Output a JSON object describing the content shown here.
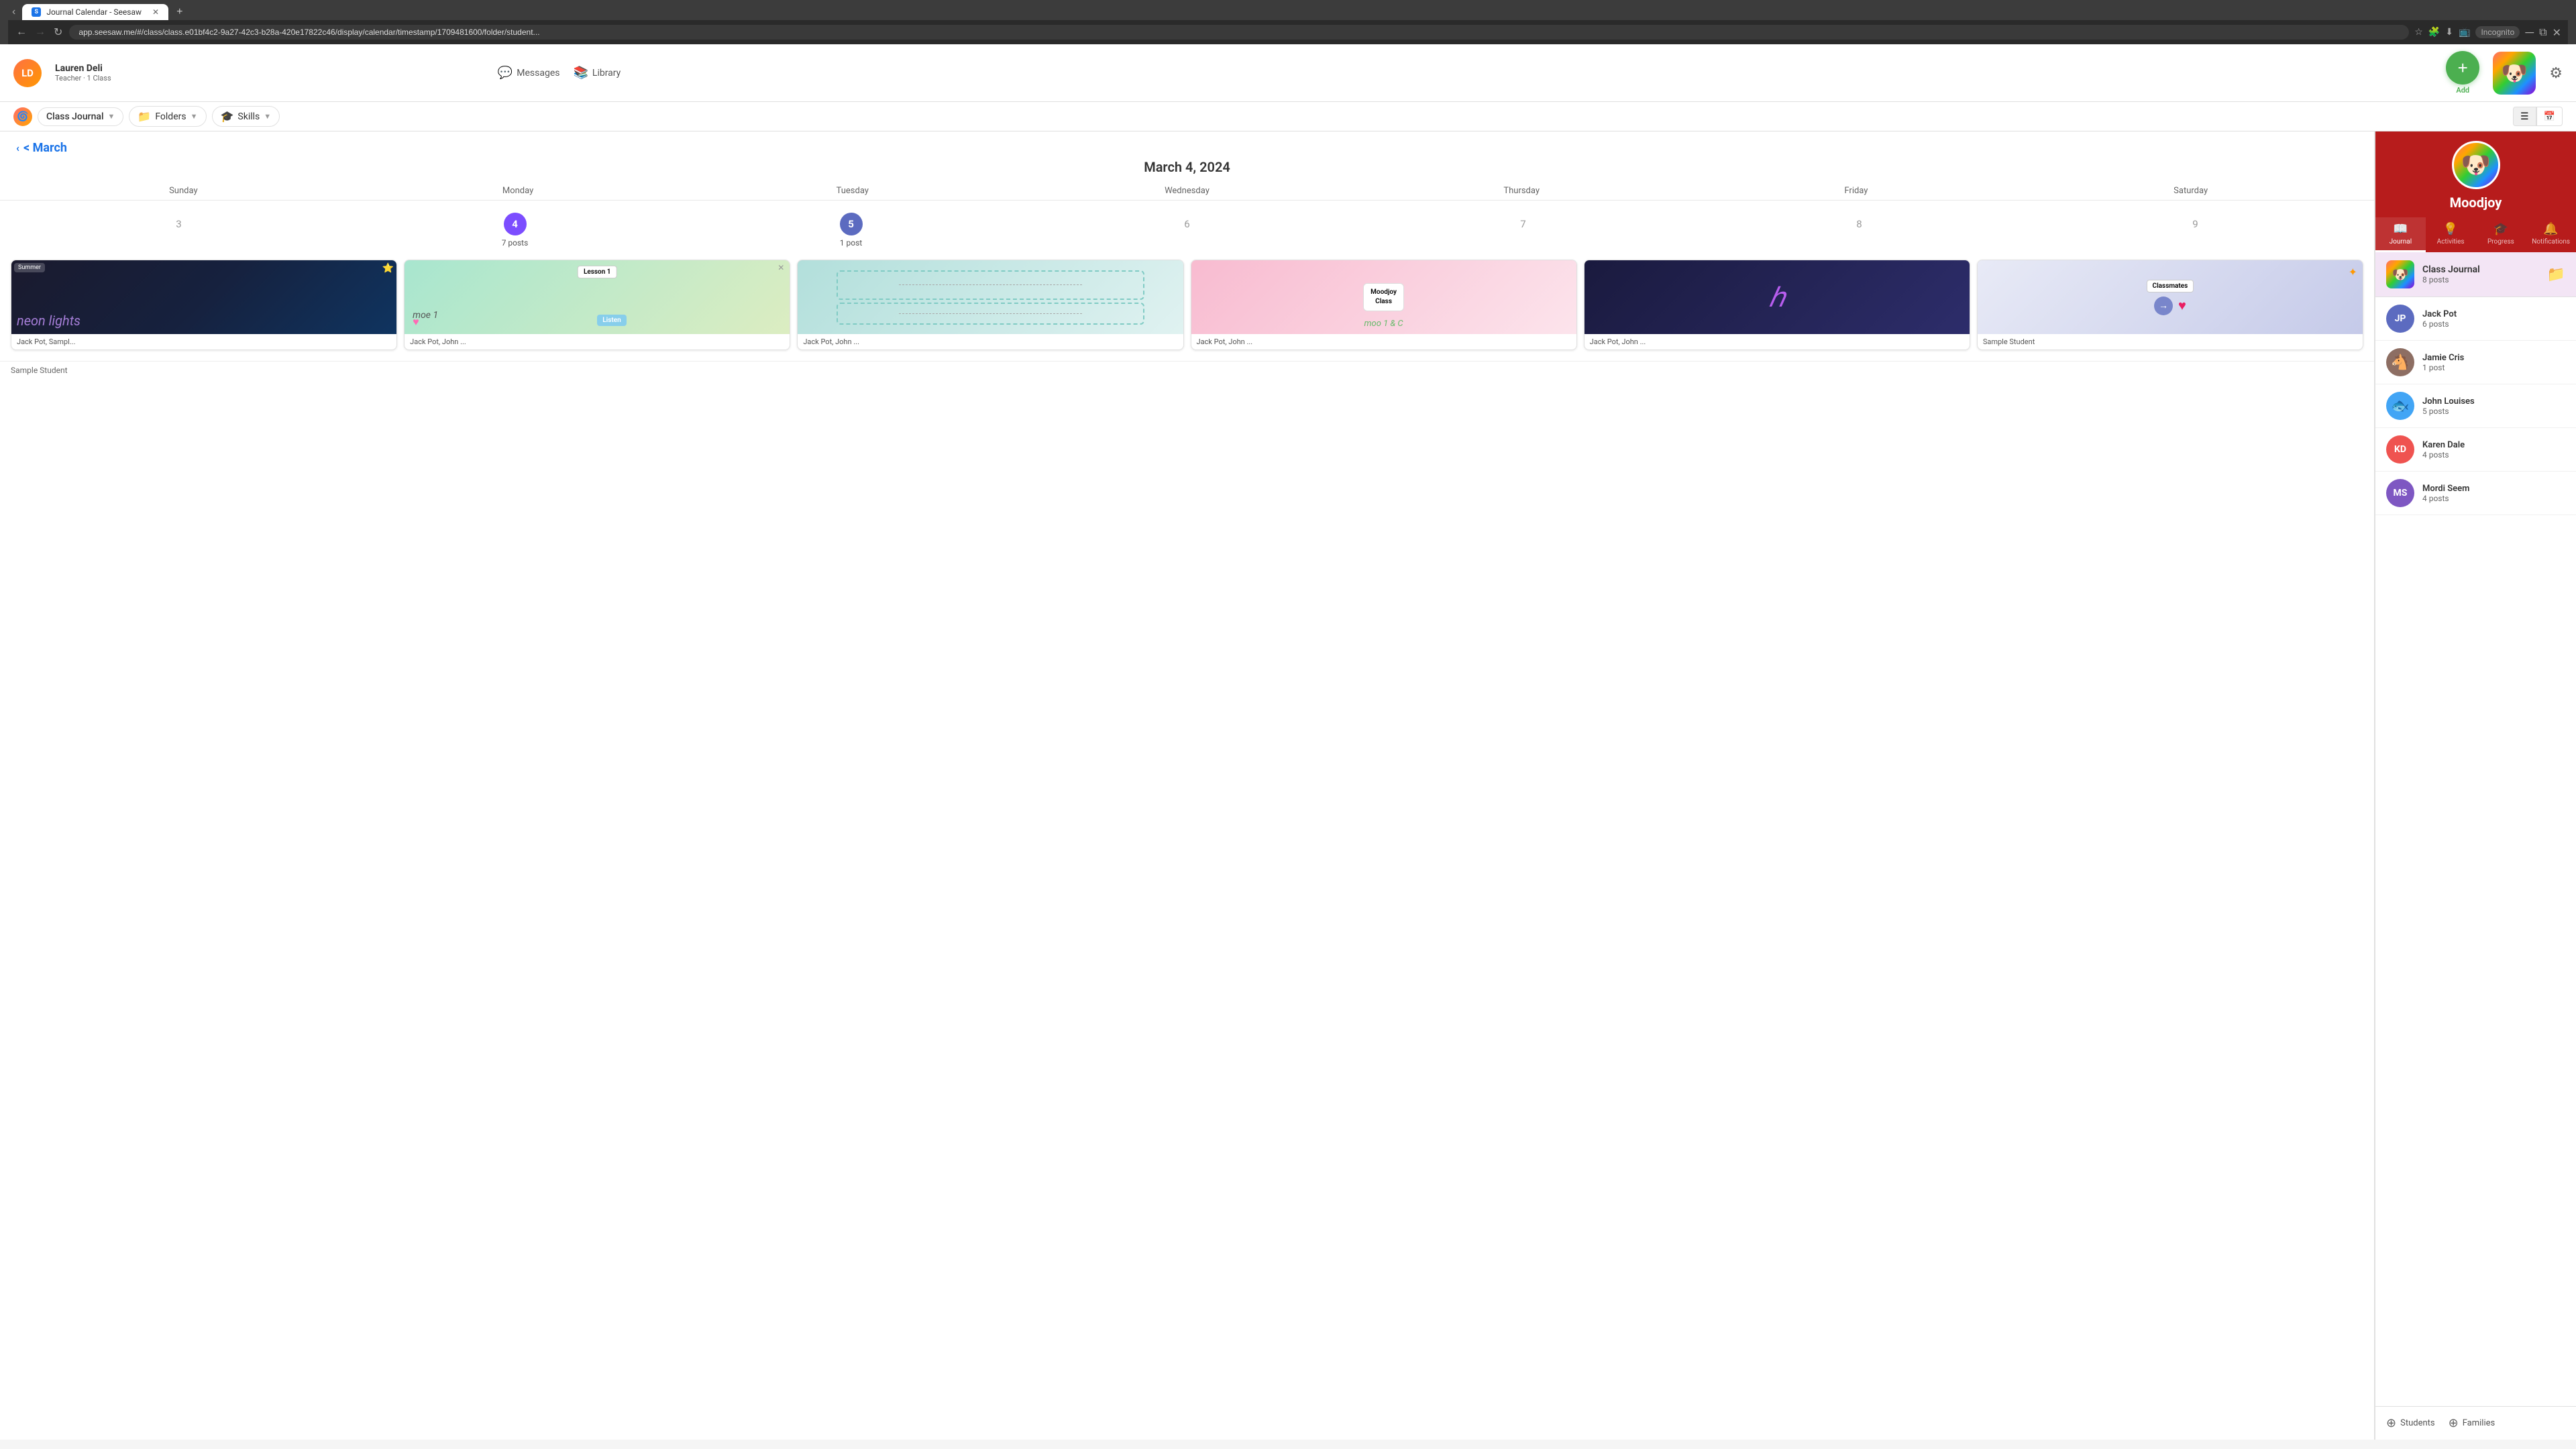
{
  "browser": {
    "tab_favicon": "S",
    "tab_title": "Journal Calendar - Seesaw",
    "address": "app.seesaw.me/#/class/class.e01bf4c2-9a27-42c3-b28a-420e17822c46/display/calendar/timestamp/1709481600/folder/student...",
    "nav_back": "←",
    "nav_forward": "→",
    "nav_reload": "↻"
  },
  "top_nav": {
    "user_initials": "LD",
    "user_name": "Lauren Deli",
    "user_role": "Teacher · 1 Class",
    "messages_label": "Messages",
    "library_label": "Library",
    "add_label": "Add",
    "gear_icon": "⚙"
  },
  "sub_nav": {
    "class_journal": "Class Journal",
    "folders": "Folders",
    "skills": "Skills"
  },
  "calendar": {
    "month_nav": "< March",
    "date_title": "March 4, 2024",
    "days": [
      "Sunday",
      "Monday",
      "Tuesday",
      "Wednesday",
      "Thursday",
      "Friday",
      "Saturday"
    ],
    "week_numbers": [
      {
        "num": "3",
        "active": false,
        "posts": ""
      },
      {
        "num": "4",
        "active": true,
        "posts": "7 posts"
      },
      {
        "num": "5",
        "active": true,
        "posts": "1 post"
      },
      {
        "num": "6",
        "active": false,
        "posts": ""
      },
      {
        "num": "7",
        "active": false,
        "posts": ""
      },
      {
        "num": "8",
        "active": false,
        "posts": ""
      },
      {
        "num": "9",
        "active": false,
        "posts": ""
      }
    ],
    "posts": [
      {
        "caption": "Jack Pot,  Sampl...",
        "thumb_class": "thumb-1"
      },
      {
        "caption": "Jack Pot,  John ...",
        "thumb_class": "thumb-2"
      },
      {
        "caption": "Jack Pot,  John ...",
        "thumb_class": "thumb-3"
      },
      {
        "caption": "Jack Pot,  John ...",
        "thumb_class": "thumb-4"
      },
      {
        "caption": "Jack Pot,  John ...",
        "thumb_class": "thumb-5"
      },
      {
        "caption": "Sample Student",
        "thumb_class": "thumb-6"
      }
    ],
    "sample_student_label": "Sample Student"
  },
  "sidebar": {
    "app_name": "Moodjoy",
    "tabs": [
      {
        "label": "Journal",
        "icon": "📖",
        "active": true
      },
      {
        "label": "Activities",
        "icon": "💡",
        "active": false
      },
      {
        "label": "Progress",
        "icon": "🎓",
        "active": false
      },
      {
        "label": "Notifications",
        "icon": "🔔",
        "active": false
      }
    ],
    "class_item": {
      "name": "Class Journal",
      "posts": "8 posts"
    },
    "students": [
      {
        "initials": "JP",
        "name": "Jack Pot",
        "posts": "6 posts",
        "color": "#5c6bc0"
      },
      {
        "initials": "🐴",
        "name": "Jamie Cris",
        "posts": "1 post",
        "color": "#8d6e63",
        "is_emoji": true
      },
      {
        "initials": "🐟",
        "name": "John Louises",
        "posts": "5 posts",
        "color": "#42a5f5",
        "is_emoji": true
      },
      {
        "initials": "KD",
        "name": "Karen Dale",
        "posts": "4 posts",
        "color": "#ef5350"
      },
      {
        "initials": "MS",
        "name": "Mordi Seem",
        "posts": "4 posts",
        "color": "#7e57c2"
      }
    ],
    "footer_students": "Students",
    "footer_families": "Families"
  }
}
